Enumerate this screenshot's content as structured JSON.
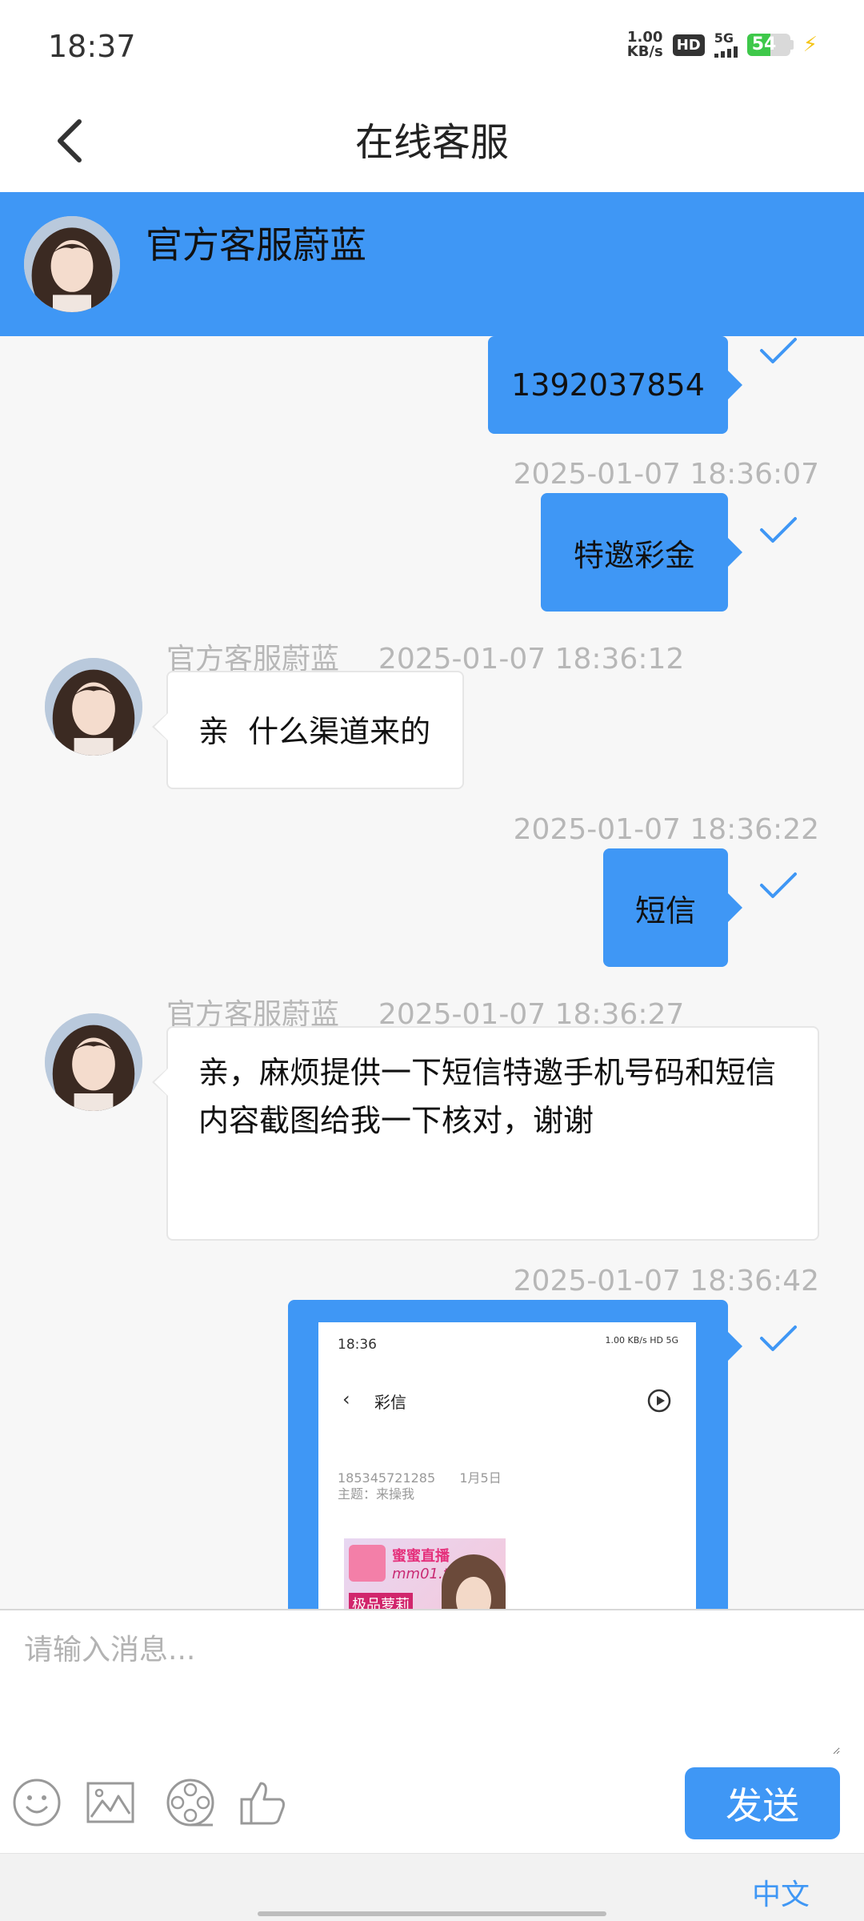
{
  "status_bar": {
    "time": "18:37",
    "net_speed_value": "1.00",
    "net_speed_unit": "KB/s",
    "hd": "HD",
    "signal": "5G",
    "battery": "54"
  },
  "header": {
    "title": "在线客服"
  },
  "agent": {
    "name": "官方客服蔚蓝"
  },
  "messages": [
    {
      "from": "user",
      "time": "",
      "text": "1392037854"
    },
    {
      "from": "user",
      "time": "2025-01-07 18:36:07",
      "text": "特邀彩金"
    },
    {
      "from": "agent",
      "sender": "官方客服蔚蓝",
      "time": "2025-01-07 18:36:12",
      "text": "亲  什么渠道来的"
    },
    {
      "from": "user",
      "time": "2025-01-07 18:36:22",
      "text": "短信"
    },
    {
      "from": "agent",
      "sender": "官方客服蔚蓝",
      "time": "2025-01-07 18:36:27",
      "text": "亲，麻烦提供一下短信特邀手机号码和短信内容截图给我一下核对，谢谢"
    },
    {
      "from": "user",
      "time": "2025-01-07 18:36:42",
      "text": ""
    }
  ],
  "screenshot": {
    "time": "18:36",
    "status": "1.00 KB/s  HD 5G",
    "title": "彩信",
    "sender": "185345721285",
    "date": "1月5日",
    "subject": "主题：来操我",
    "ad_brand": "蜜蜜直播",
    "ad_url": "mm01.tv",
    "ad_tag": "极品萝莉"
  },
  "input": {
    "placeholder": "请输入消息..."
  },
  "toolbar": {
    "send_label": "发送",
    "language": "中文"
  },
  "colors": {
    "accent": "#3f97f5",
    "battery": "#3ec84a"
  }
}
